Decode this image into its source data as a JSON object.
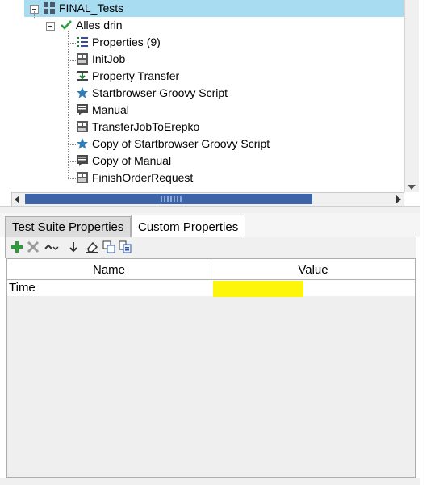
{
  "tree": {
    "items": [
      {
        "label": "FINAL_Tests",
        "icon": "grid-icon"
      },
      {
        "label": "Alles drin",
        "icon": "checkmark-icon"
      },
      {
        "label": "Properties (9)",
        "icon": "properties-icon"
      },
      {
        "label": "InitJob",
        "icon": "job-step-icon"
      },
      {
        "label": "Property Transfer",
        "icon": "property-transfer-icon"
      },
      {
        "label": "Startbrowser Groovy Script",
        "icon": "star-icon"
      },
      {
        "label": "Manual",
        "icon": "manual-icon"
      },
      {
        "label": "TransferJobToErepko",
        "icon": "job-step-icon"
      },
      {
        "label": "Copy of Startbrowser Groovy Script",
        "icon": "star-icon"
      },
      {
        "label": "Copy of Manual",
        "icon": "manual-icon"
      },
      {
        "label": "FinishOrderRequest",
        "icon": "job-step-icon"
      }
    ]
  },
  "tabs": [
    {
      "label": "Test Suite Properties"
    },
    {
      "label": "Custom Properties"
    }
  ],
  "toolbar": {
    "icons": [
      "add-icon",
      "remove-icon",
      "move-up-icon",
      "move-down-icon",
      "clear-icon",
      "copy-icon",
      "load-icon"
    ]
  },
  "table": {
    "headers": {
      "name": "Name",
      "value": "Value"
    },
    "rows": [
      {
        "name": "Time",
        "value": ""
      }
    ]
  },
  "colors": {
    "selection": "#a8dcf0",
    "highlight": "#fdf60a",
    "accent_green": "#2a9d3a",
    "scroll_thumb": "#3e64a8"
  }
}
